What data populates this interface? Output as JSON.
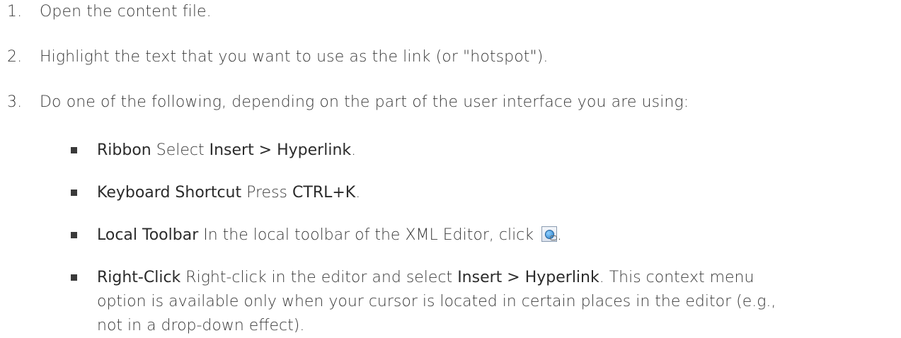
{
  "steps": [
    {
      "num": "1.",
      "text": "Open the content file."
    },
    {
      "num": "2.",
      "text": "Highlight the text that you want to use as the link (or \"hotspot\")."
    },
    {
      "num": "3.",
      "text": "Do one of the following, depending on the part of the user interface you are using:"
    }
  ],
  "options": {
    "ribbon": {
      "label": "Ribbon",
      "pre": " Select ",
      "command": "Insert > Hyperlink",
      "post": "."
    },
    "keyboard": {
      "label": "Keyboard Shortcut",
      "pre": " Press ",
      "command": "CTRL+K",
      "post": "."
    },
    "toolbar": {
      "label": "Local Toolbar",
      "pre": " In the local toolbar of the XML Editor, click ",
      "icon": "insert-hyperlink-icon",
      "post": "."
    },
    "rightclick": {
      "label": "Right-Click",
      "line1_pre": " Right-click in the editor and select ",
      "command": "Insert > Hyperlink",
      "line1_post": ". This context menu",
      "line2": "option is available only when your cursor is located in certain places in the editor (e.g.,",
      "line3": "not in a drop-down effect)."
    }
  }
}
